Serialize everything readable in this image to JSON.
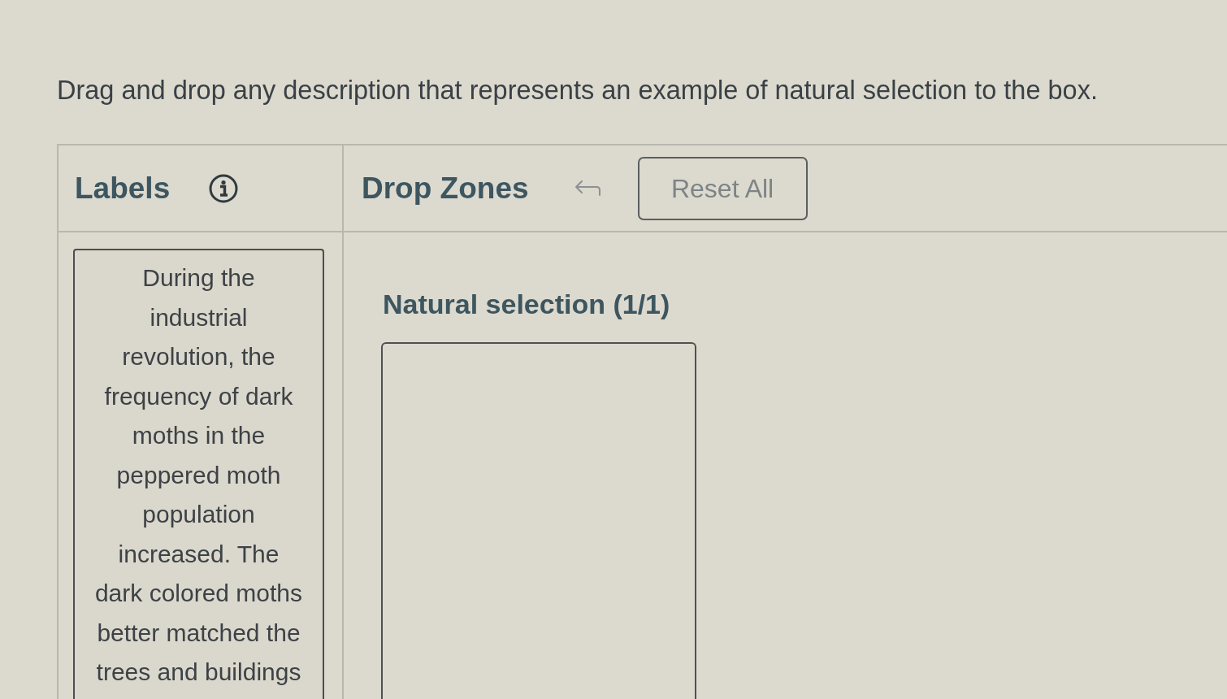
{
  "instruction": "Drag and drop any description that represents an example of natural selection to the box.",
  "labels_panel": {
    "title": "Labels",
    "cards": [
      "During the industrial revolution, the frequency of dark moths in the peppered moth population increased. The dark colored moths better matched the trees and buildings"
    ]
  },
  "drop_zones_panel": {
    "title": "Drop Zones",
    "undo": {
      "disabled": true
    },
    "reset_button": {
      "label": "Reset All",
      "disabled": true
    },
    "zones": [
      {
        "label": "Natural selection (1/1)"
      }
    ]
  }
}
